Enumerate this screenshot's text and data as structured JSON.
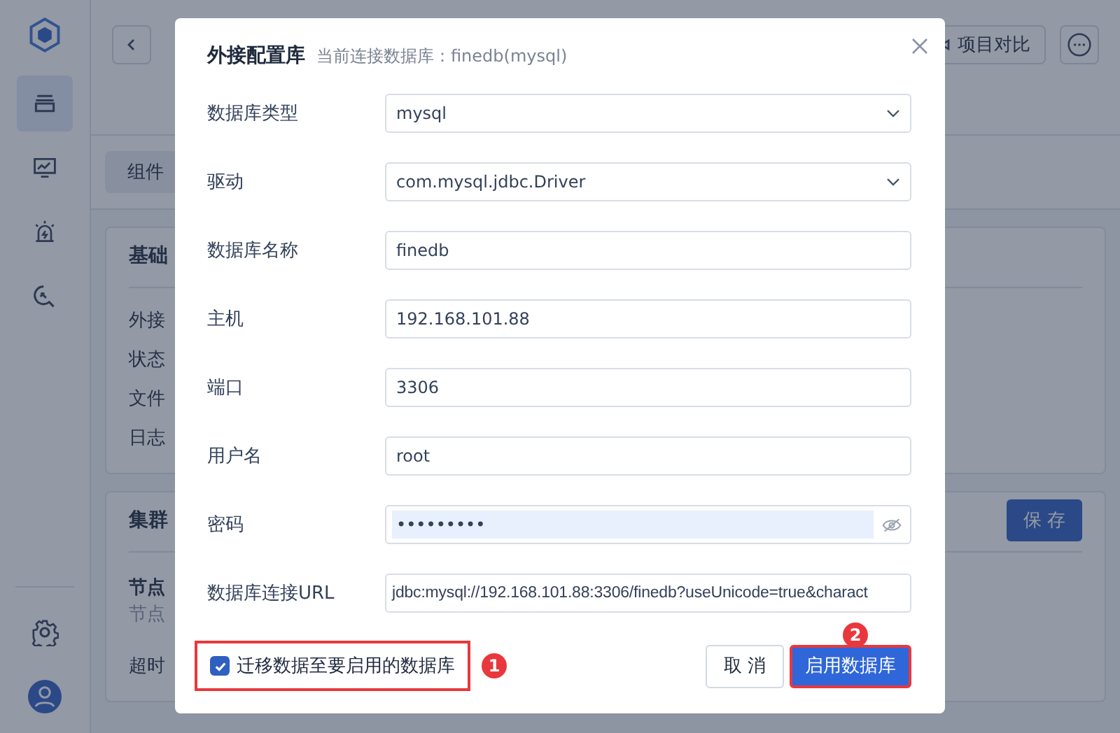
{
  "sidebar": {
    "items": [
      {
        "kind": "layers",
        "selected": true
      },
      {
        "kind": "monitor",
        "selected": false
      },
      {
        "kind": "alarm",
        "selected": false
      },
      {
        "kind": "wrench",
        "selected": false
      }
    ]
  },
  "header": {
    "compare_button": "项目对比"
  },
  "subtab": "组件",
  "cards": [
    {
      "title": "基础",
      "rows": [
        {
          "kind": "label",
          "text": "外接"
        },
        {
          "kind": "label",
          "text": "状态"
        },
        {
          "kind": "label",
          "text": "文件"
        },
        {
          "kind": "label",
          "text": "日志"
        }
      ]
    },
    {
      "title": "集群",
      "button": "保 存",
      "rows": [
        {
          "kind": "heading",
          "text": "节点"
        },
        {
          "kind": "hint",
          "text": "节点"
        },
        {
          "kind": "label",
          "text": "超时"
        }
      ]
    }
  ],
  "dialog": {
    "title": "外接配置库",
    "subtitle": "当前连接数据库：finedb(mysql)",
    "fields": [
      {
        "label": "数据库类型",
        "kind": "select",
        "value": "mysql"
      },
      {
        "label": "驱动",
        "kind": "select",
        "value": "com.mysql.jdbc.Driver"
      },
      {
        "label": "数据库名称",
        "kind": "text",
        "value": "finedb"
      },
      {
        "label": "主机",
        "kind": "text",
        "value": "192.168.101.88"
      },
      {
        "label": "端口",
        "kind": "text",
        "value": "3306"
      },
      {
        "label": "用户名",
        "kind": "text",
        "value": "root"
      },
      {
        "label": "密码",
        "kind": "password",
        "value": "•••••••••"
      },
      {
        "label": "数据库连接URL",
        "kind": "url",
        "value": "jdbc:mysql://192.168.101.88:3306/finedb?useUnicode=true&charact"
      }
    ],
    "migrate": {
      "label": "迁移数据至要启用的数据库",
      "checked": true,
      "annotation": "1"
    },
    "buttons": [
      {
        "label": "取 消",
        "kind": "secondary"
      },
      {
        "label": "启用数据库",
        "kind": "primary",
        "annotation": "2"
      }
    ]
  }
}
